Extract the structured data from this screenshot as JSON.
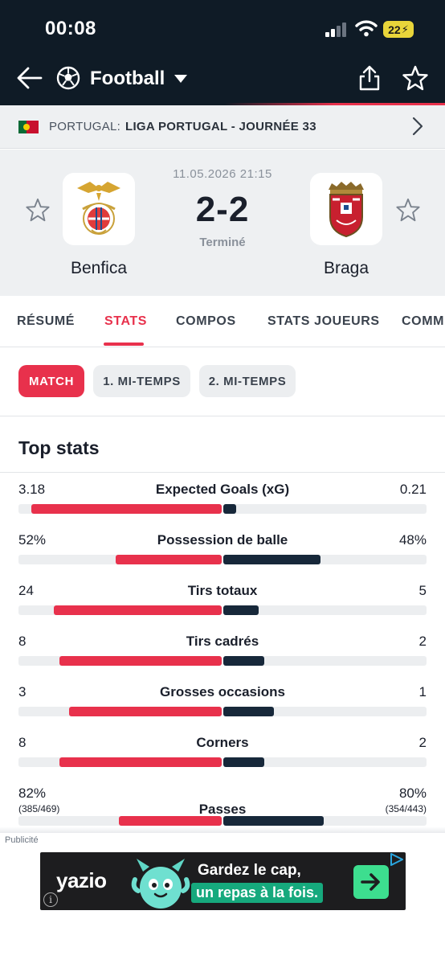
{
  "status_bar": {
    "time": "00:08",
    "battery": "22"
  },
  "header": {
    "title": "Football"
  },
  "league": {
    "country": "PORTUGAL:",
    "name": "LIGA PORTUGAL - JOURNÉE 33"
  },
  "match": {
    "date": "11.05.2026 21:15",
    "score": "2-2",
    "status": "Terminé",
    "home": "Benfica",
    "away": "Braga"
  },
  "tabs": [
    "RÉSUMÉ",
    "STATS",
    "COMPOS",
    "STATS JOUEURS",
    "COMM"
  ],
  "periods": [
    "MATCH",
    "1. MI-TEMPS",
    "2. MI-TEMPS"
  ],
  "section_title": "Top stats",
  "stats": [
    {
      "label": "Expected Goals (xG)",
      "home": "3.18",
      "away": "0.21",
      "home_share": 0.938,
      "away_share": 0.062
    },
    {
      "label": "Possession de balle",
      "home": "52%",
      "away": "48%",
      "home_share": 0.52,
      "away_share": 0.48
    },
    {
      "label": "Tirs totaux",
      "home": "24",
      "away": "5",
      "home_share": 0.828,
      "away_share": 0.172
    },
    {
      "label": "Tirs cadrés",
      "home": "8",
      "away": "2",
      "home_share": 0.8,
      "away_share": 0.2
    },
    {
      "label": "Grosses occasions",
      "home": "3",
      "away": "1",
      "home_share": 0.75,
      "away_share": 0.25
    },
    {
      "label": "Corners",
      "home": "8",
      "away": "2",
      "home_share": 0.8,
      "away_share": 0.2
    },
    {
      "label": "Passes",
      "home": "82%",
      "away": "80%",
      "home_sub": "(385/469)",
      "away_sub": "(354/443)",
      "home_share": 0.506,
      "away_share": 0.494
    }
  ],
  "ad": {
    "label": "Publicité",
    "brand": "yazio",
    "line1": "Gardez le cap,",
    "line2": "un repas à la fois."
  },
  "colors": {
    "home": "#e8314c",
    "away": "#17283a",
    "header_bg": "#0f1b26"
  }
}
